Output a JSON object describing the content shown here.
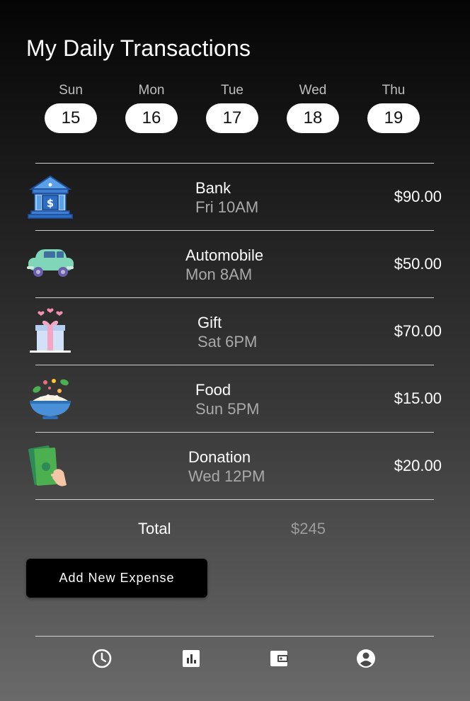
{
  "header": {
    "title": "My Daily Transactions"
  },
  "days": [
    {
      "name": "Sun",
      "date": "15"
    },
    {
      "name": "Mon",
      "date": "16"
    },
    {
      "name": "Tue",
      "date": "17"
    },
    {
      "name": "Wed",
      "date": "18"
    },
    {
      "name": "Thu",
      "date": "19"
    }
  ],
  "transactions": [
    {
      "name": "Bank",
      "time": "Fri 10AM",
      "amount": "$90.00",
      "icon": "bank-icon"
    },
    {
      "name": "Automobile",
      "time": "Mon 8AM",
      "amount": "$50.00",
      "icon": "car-icon"
    },
    {
      "name": "Gift",
      "time": "Sat 6PM",
      "amount": "$70.00",
      "icon": "gift-icon"
    },
    {
      "name": "Food",
      "time": "Sun 5PM",
      "amount": "$15.00",
      "icon": "food-bowl-icon"
    },
    {
      "name": "Donation",
      "time": "Wed 12PM",
      "amount": "$20.00",
      "icon": "cash-hand-icon"
    }
  ],
  "summary": {
    "total_label": "Total",
    "total_value": "$245"
  },
  "actions": {
    "add_label": "Add New Expense"
  },
  "nav": [
    {
      "icon": "clock-icon"
    },
    {
      "icon": "bar-chart-icon"
    },
    {
      "icon": "wallet-icon"
    },
    {
      "icon": "account-circle-icon"
    }
  ]
}
